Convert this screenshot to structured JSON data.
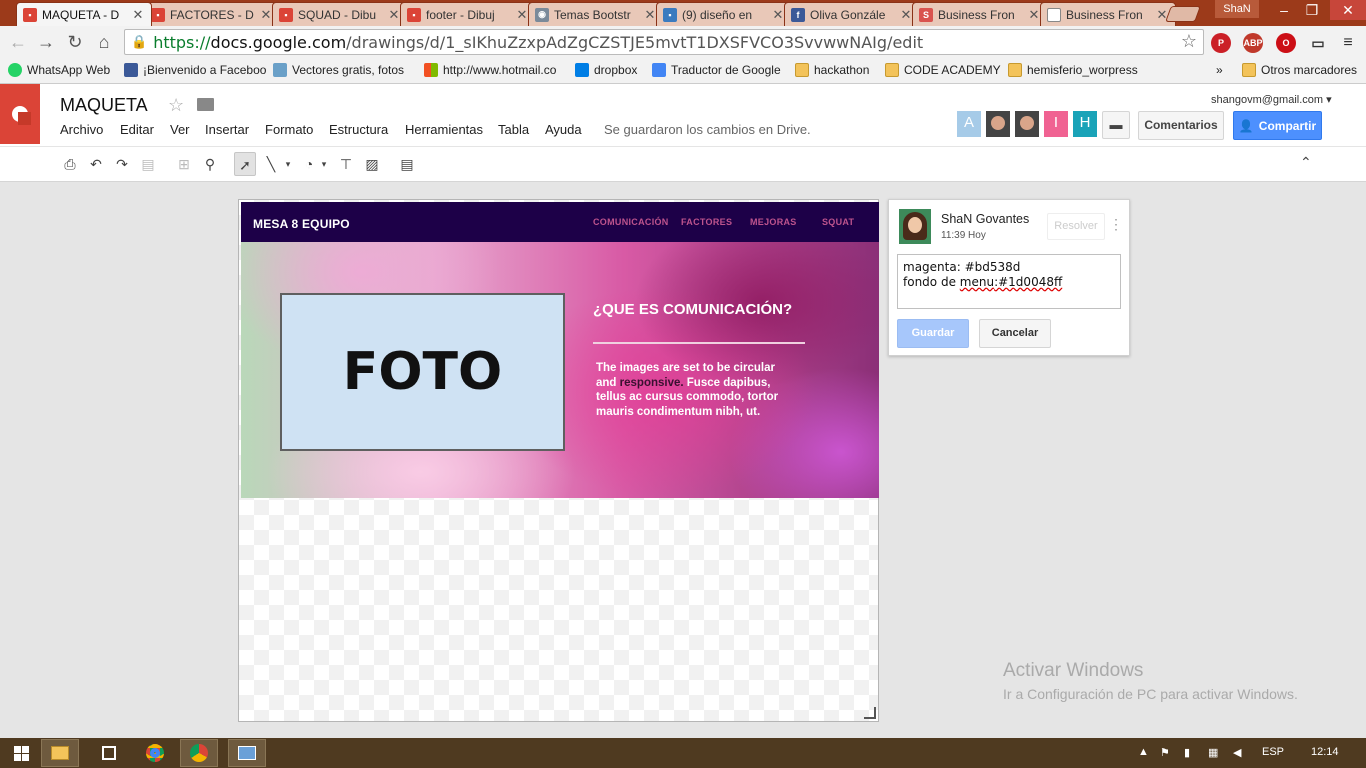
{
  "tabs": [
    {
      "title": "MAQUETA - D",
      "favicon_color": "#db4437",
      "active": true
    },
    {
      "title": "FACTORES - D",
      "favicon_color": "#db4437",
      "active": false
    },
    {
      "title": "SQUAD - Dibu",
      "favicon_color": "#db4437",
      "active": false
    },
    {
      "title": "footer - Dibuj",
      "favicon_color": "#db4437",
      "active": false
    },
    {
      "title": "Temas Bootstr",
      "favicon_color": "#7a8a9a",
      "active": false
    },
    {
      "title": "(9) diseño en",
      "favicon_color": "#3b7bbf",
      "active": false
    },
    {
      "title": "Oliva Gonzále",
      "favicon_color": "#3b5998",
      "active": false
    },
    {
      "title": "Business Fron",
      "favicon_color": "#d9534f",
      "active": false
    },
    {
      "title": "Business Fron",
      "favicon_color": "#ffffff",
      "active": false
    }
  ],
  "browser": {
    "user_chip": "ShaN",
    "url_scheme": "https://",
    "url_host": "docs.google.com",
    "url_path": "/drawings/d/1_sIKhuZzxpAdZgCZSTJE5mvtT1DXSFVCO3SvvwwNAIg/edit",
    "extensions": [
      "pinterest-icon",
      "adblock-icon",
      "opera-icon",
      "cast-icon",
      "menu-icon"
    ]
  },
  "bookmarks": [
    {
      "label": "WhatsApp Web",
      "icon": "whatsapp-icon"
    },
    {
      "label": "¡Bienvenido a Faceboo",
      "icon": "facebook-icon"
    },
    {
      "label": "Vectores gratis, fotos",
      "icon": "freepik-icon"
    },
    {
      "label": "http://www.hotmail.co",
      "icon": "windows-icon"
    },
    {
      "label": "dropbox",
      "icon": "dropbox-icon"
    },
    {
      "label": "Traductor de Google",
      "icon": "translate-icon"
    },
    {
      "label": "hackathon",
      "icon": "folder-icon"
    },
    {
      "label": "CODE ACADEMY",
      "icon": "folder-icon"
    },
    {
      "label": "hemisferio_worpress",
      "icon": "folder-icon"
    }
  ],
  "bookmarks_more": "»",
  "bookmarks_other": "Otros marcadores",
  "doc": {
    "title": "MAQUETA",
    "menus": [
      "Archivo",
      "Editar",
      "Ver",
      "Insertar",
      "Formato",
      "Estructura",
      "Herramientas",
      "Tabla",
      "Ayuda"
    ],
    "save_status": "Se guardaron los cambios en Drive.",
    "account": "shangovm@gmail.com",
    "collaborators": [
      {
        "initial": "A",
        "color": "#a6cbe8"
      },
      {
        "initial": "",
        "color": "#444444"
      },
      {
        "initial": "",
        "color": "#444444"
      },
      {
        "initial": "I",
        "color": "#f06292"
      },
      {
        "initial": "H",
        "color": "#1aa3b8"
      }
    ],
    "comments_label": "Comentarios",
    "share_label": "Compartir"
  },
  "mockup": {
    "brand": "MESA 8 EQUIPO",
    "nav": [
      "COMUNICACIÓN",
      "FACTORES",
      "MEJORAS",
      "SQUAT"
    ],
    "photo_label": "FOTO",
    "heading": "¿QUE ES COMUNICACIÓN?",
    "body_start": "The images are set to be circular and",
    "body_highlight": "responsive.",
    "body_end": "Fusce dapibus, tellus ac cursus commodo, tortor mauris condimentum nibh, ut.",
    "nav_bg": "#1d0048",
    "link_color": "#bd538d"
  },
  "comment": {
    "author": "ShaN Govantes",
    "time": "11:39 Hoy",
    "resolve": "Resolver",
    "line1": "magenta: #bd538d",
    "line2_a": "fondo de",
    "line2_b": "menu",
    "line2_c": ":#1d0048ff",
    "save": "Guardar",
    "cancel": "Cancelar"
  },
  "watermark": {
    "title": "Activar Windows",
    "subtitle": "Ir a Configuración de PC para activar Windows."
  },
  "taskbar": {
    "lang": "ESP",
    "clock": "12:14"
  }
}
